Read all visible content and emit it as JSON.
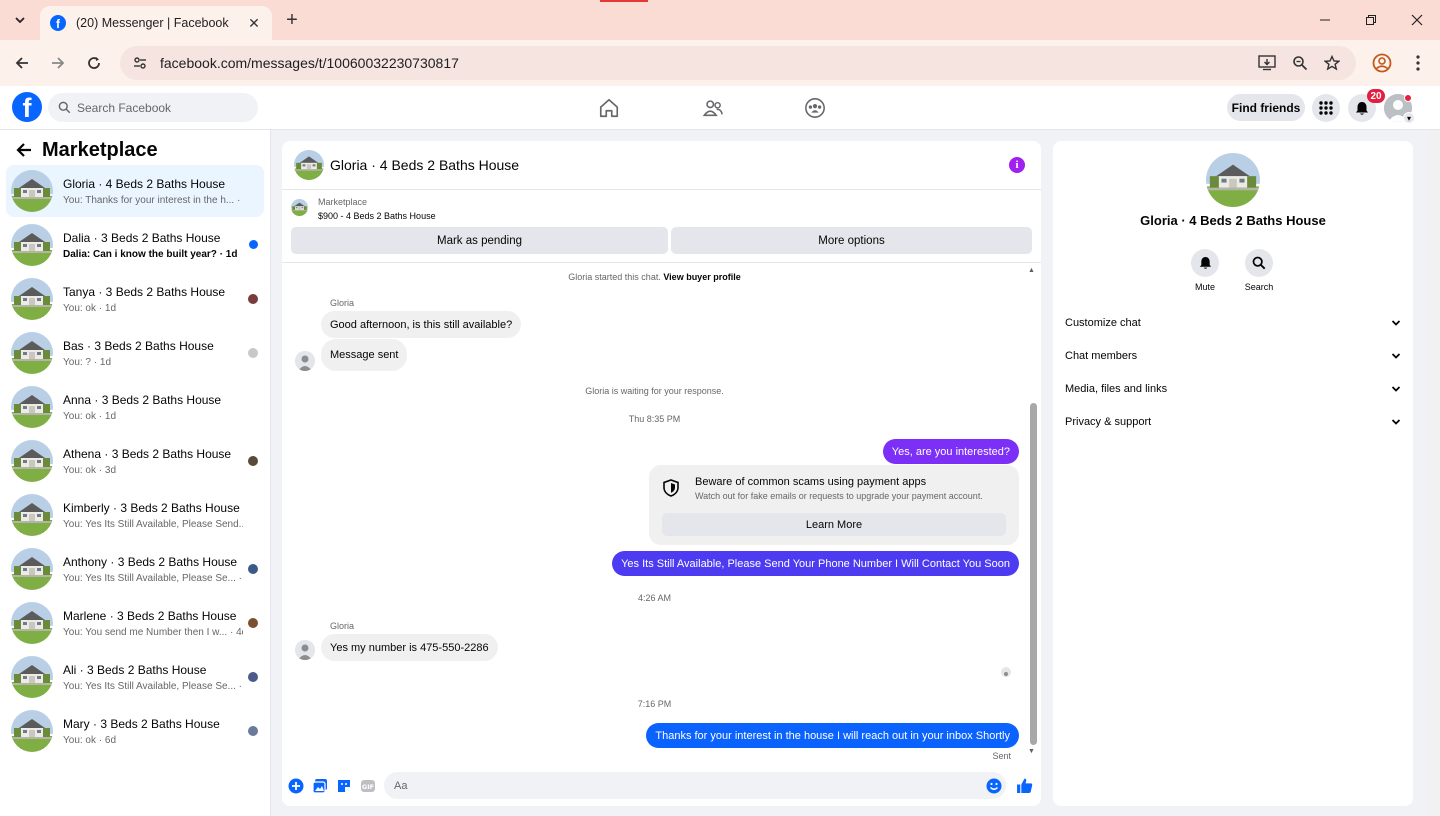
{
  "browser": {
    "tab_title": "(20) Messenger | Facebook",
    "url": "facebook.com/messages/t/10060032230730817"
  },
  "header": {
    "search_placeholder": "Search Facebook",
    "find_friends_label": "Find friends",
    "notification_count": "20"
  },
  "sidebar": {
    "title": "Marketplace",
    "conversations": [
      {
        "name": "Gloria · 4 Beds 2 Baths House",
        "preview": "You: Thanks for your interest in the h... · 1m",
        "active": true,
        "unread": false
      },
      {
        "name": "Dalia · 3 Beds 2 Baths House",
        "preview": "Dalia: Can i know the built year? · 1d",
        "active": false,
        "unread": true
      },
      {
        "name": "Tanya · 3 Beds 2 Baths House",
        "preview": "You: ok · 1d",
        "active": false,
        "unread": false
      },
      {
        "name": "Bas · 3 Beds 2 Baths House",
        "preview": "You: ? · 1d",
        "active": false,
        "unread": false
      },
      {
        "name": "Anna · 3 Beds 2 Baths House",
        "preview": "You: ok · 1d",
        "active": false,
        "unread": false
      },
      {
        "name": "Athena · 3 Beds 2 Baths House",
        "preview": "You: ok · 3d",
        "active": false,
        "unread": false
      },
      {
        "name": "Kimberly · 3 Beds 2 Baths House",
        "preview": "You: Yes Its Still Available, Please Send... · 3d",
        "active": false,
        "unread": false
      },
      {
        "name": "Anthony · 3 Beds 2 Baths House",
        "preview": "You: Yes Its Still Available, Please Se... · 3d",
        "active": false,
        "unread": false
      },
      {
        "name": "Marlene · 3 Beds 2 Baths House",
        "preview": "You: You send me Number then I w... · 4d",
        "active": false,
        "unread": false
      },
      {
        "name": "Ali · 3 Beds 2 Baths House",
        "preview": "You: Yes Its Still Available, Please Se... · 4d",
        "active": false,
        "unread": false
      },
      {
        "name": "Mary · 3 Beds 2 Baths House",
        "preview": "You: ok · 6d",
        "active": false,
        "unread": false
      }
    ]
  },
  "chat": {
    "title": "Gloria · 4 Beds 2 Baths House",
    "listing_label": "Marketplace",
    "listing_price": "$900 - 4 Beds 2 Baths House",
    "mark_pending_label": "Mark as pending",
    "more_options_label": "More options",
    "started_note": "Gloria started this chat.",
    "view_profile_label": "View buyer profile",
    "sender_name": "Gloria",
    "msg1": "Good afternoon, is this still available?",
    "msg2": "Message sent",
    "waiting_note": "Gloria is waiting for your response.",
    "time1": "Thu 8:35 PM",
    "out1": "Yes, are you interested?",
    "scam_title": "Beware of common scams using payment apps",
    "scam_text": "Watch out for fake emails or requests to upgrade your payment account.",
    "learn_more_label": "Learn More",
    "out2": "Yes Its Still Available, Please Send Your Phone Number I Will Contact You Soon",
    "time2": "4:26 AM",
    "msg3": "Yes my number is 475-550-2286",
    "time3": "7:16 PM",
    "out3": "Thanks for your interest in the house I will reach out in your inbox Shortly",
    "sent_status": "Sent",
    "composer_placeholder": "Aa"
  },
  "info_panel": {
    "name": "Gloria · 4 Beds 2 Baths House",
    "mute_label": "Mute",
    "search_label": "Search",
    "sections": [
      "Customize chat",
      "Chat members",
      "Media, files and links",
      "Privacy & support"
    ]
  },
  "colors": {
    "fb_blue": "#0866ff",
    "bubble_purple": "#7b2ff7",
    "bubble_blue_violet": "#4c3bf0",
    "bubble_blue": "#0a62ff",
    "unread_dot": "#0866ff"
  }
}
